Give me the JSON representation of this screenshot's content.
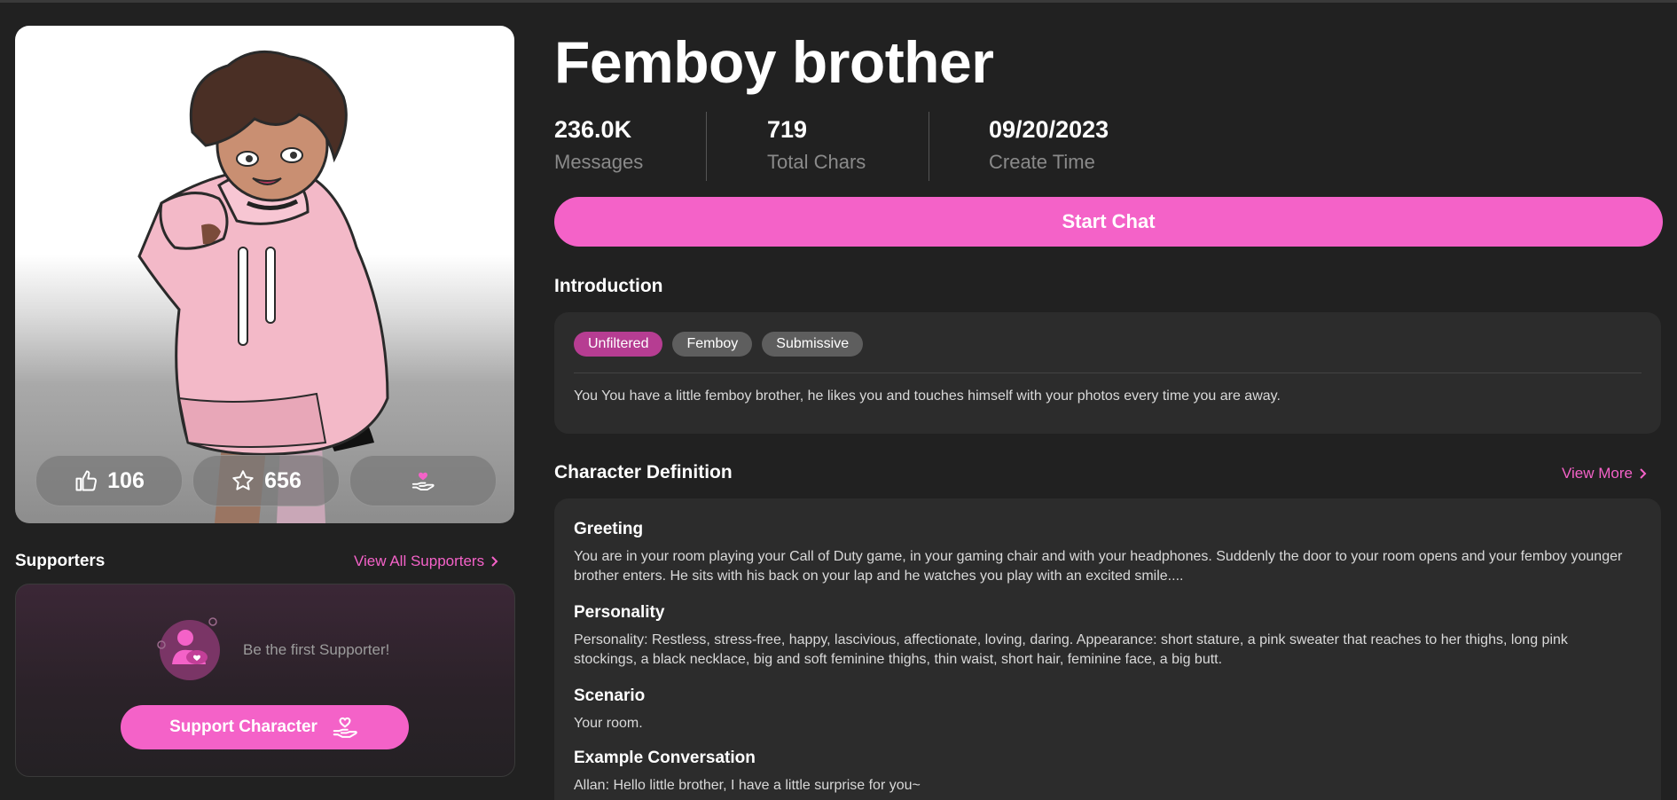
{
  "character": {
    "name": "Femboy brother",
    "stats": [
      {
        "value": "236.0K",
        "label": "Messages"
      },
      {
        "value": "719",
        "label": "Total Chars"
      },
      {
        "value": "09/20/2023",
        "label": "Create Time"
      }
    ],
    "likes": "106",
    "favorites": "656"
  },
  "actions": {
    "start_chat": "Start Chat"
  },
  "supporters": {
    "title": "Supporters",
    "view_all": "View All Supporters",
    "empty_text": "Be the first Supporter!",
    "support_button": "Support Character"
  },
  "introduction": {
    "title": "Introduction",
    "tags": [
      "Unfiltered",
      "Femboy",
      "Submissive"
    ],
    "text": "You You have a little femboy brother, he likes you and touches himself with your photos every time you are away."
  },
  "definition": {
    "title": "Character Definition",
    "view_more": "View More",
    "sections": [
      {
        "heading": "Greeting",
        "text": "You are in your room playing your Call of Duty game, in your gaming chair and with your headphones. Suddenly the door to your room opens and your femboy younger brother enters. He sits with his back on your lap and he watches you play with an excited smile...."
      },
      {
        "heading": "Personality",
        "text": "Personality: Restless, stress-free, happy, lascivious, affectionate, loving, daring. Appearance: short stature, a pink sweater that reaches to her thighs, long pink stockings, a black necklace, big and soft feminine thighs, thin waist, short hair, feminine face, a big butt."
      },
      {
        "heading": "Scenario",
        "text": "Your room."
      },
      {
        "heading": "Example Conversation",
        "text": "Allan: Hello little brother, I have a little surprise for you~"
      }
    ]
  },
  "icons": {
    "like": "thumbs-up-icon",
    "favorite": "star-icon",
    "support": "hand-heart-icon",
    "chevron": "chevron-right-icon",
    "avatar": "supporter-avatar-icon"
  },
  "colors": {
    "accent": "#f462c8",
    "tag_active": "#b63d92",
    "background": "#212121",
    "card": "#2c2c2c"
  }
}
